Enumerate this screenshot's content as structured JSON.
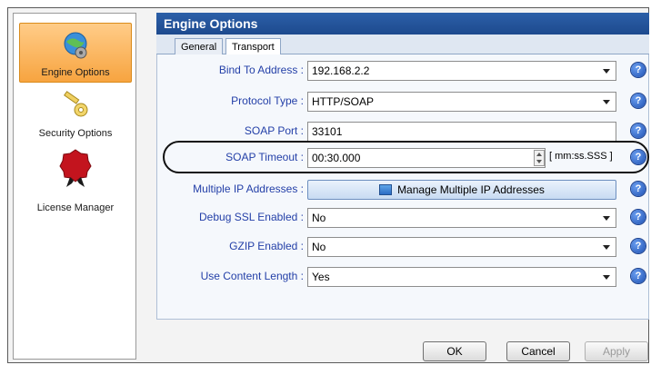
{
  "sidebar": {
    "items": [
      {
        "label": "Engine Options",
        "icon": "globe-gear-icon",
        "active": true
      },
      {
        "label": "Security Options",
        "icon": "key-icon",
        "active": false
      },
      {
        "label": "License Manager",
        "icon": "wax-seal-icon",
        "active": false
      }
    ]
  },
  "header": {
    "title": "Engine Options"
  },
  "tabs": [
    {
      "label": "General",
      "active": false
    },
    {
      "label": "Transport",
      "active": true
    }
  ],
  "form": {
    "bind_to_address": {
      "label": "Bind To Address :",
      "value": "192.168.2.2"
    },
    "protocol_type": {
      "label": "Protocol Type :",
      "value": "HTTP/SOAP"
    },
    "soap_port": {
      "label": "SOAP Port :",
      "value": "33101"
    },
    "soap_timeout": {
      "label": "SOAP Timeout :",
      "value": "00:30.000",
      "unit": "[ mm:ss.SSS ]"
    },
    "multiple_ip": {
      "label": "Multiple IP Addresses :",
      "button": "Manage Multiple IP Addresses"
    },
    "debug_ssl": {
      "label": "Debug SSL Enabled :",
      "value": "No"
    },
    "gzip": {
      "label": "GZIP Enabled :",
      "value": "No"
    },
    "content_length": {
      "label": "Use Content Length :",
      "value": "Yes"
    }
  },
  "help_glyph": "?",
  "footer": {
    "ok": "OK",
    "cancel": "Cancel",
    "apply": "Apply"
  },
  "colors": {
    "header": "#1d4a8e",
    "label": "#2440a8",
    "active_item": "#f7a440"
  }
}
